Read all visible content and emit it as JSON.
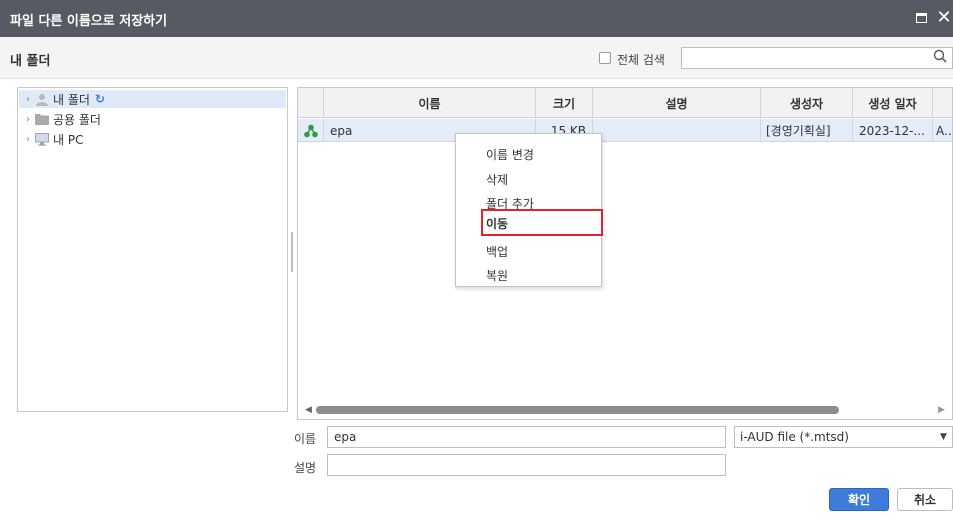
{
  "dialog": {
    "title": "파일 다른 이름으로 저장하기"
  },
  "header": {
    "folder_title": "내 폴더",
    "search_all_label": "전체 검색",
    "search_value": ""
  },
  "tree": {
    "items": [
      {
        "label": "내 폴더",
        "icon": "user-folder-icon",
        "selected": true
      },
      {
        "label": "공용 폴더",
        "icon": "folder-icon",
        "selected": false
      },
      {
        "label": "내 PC",
        "icon": "pc-icon",
        "selected": false
      }
    ]
  },
  "grid": {
    "columns": [
      "이름",
      "크기",
      "설명",
      "생성자",
      "생성 일자"
    ],
    "rows": [
      {
        "icon": "share-icon",
        "name": "epa",
        "size": "15 KB",
        "description": "",
        "creator": "[경영기획실]",
        "created": "2023-12-...",
        "extra": "A..."
      }
    ]
  },
  "context_menu": {
    "items": [
      "이름 변경",
      "삭제",
      "폴더 추가",
      "이동",
      "백업",
      "복원"
    ],
    "highlighted": "이동"
  },
  "form": {
    "name_label": "이름",
    "name_value": "epa",
    "file_type": "i-AUD file (*.mtsd)",
    "description_label": "설명",
    "description_value": ""
  },
  "buttons": {
    "ok": "확인",
    "cancel": "취소"
  },
  "colors": {
    "titlebar": "#555a63",
    "primary_button": "#3d7cdb",
    "selection": "#e3ecf8",
    "highlight_border": "#e0242f",
    "share_icon": "#2e9b4a"
  }
}
